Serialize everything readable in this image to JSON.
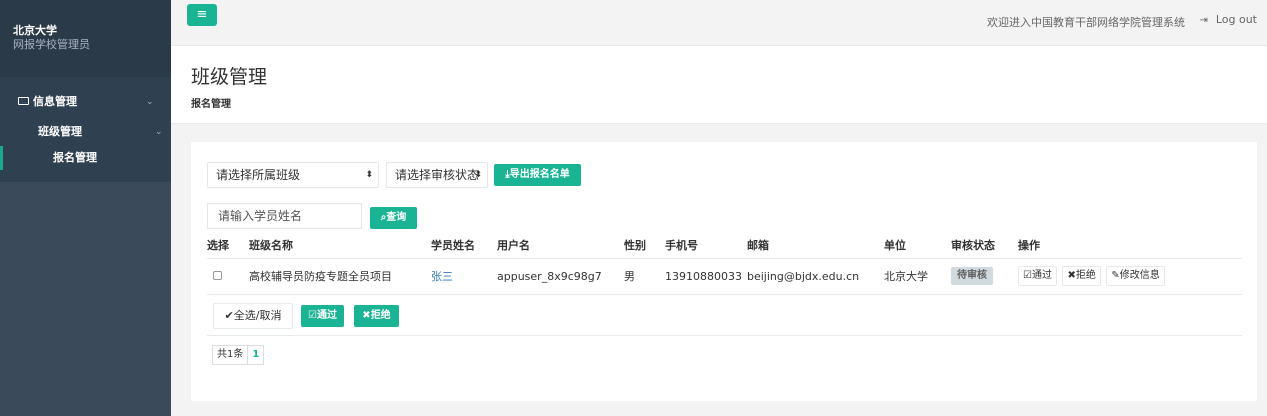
{
  "sidebar": {
    "org_name": "北京大学",
    "role_name": "网报学校管理员",
    "menu": {
      "info_mgmt": "信息管理",
      "class_mgmt": "班级管理",
      "signup_mgmt": "报名管理"
    }
  },
  "topbar": {
    "menu_icon": "≡",
    "welcome": "欢迎进入中国教育干部网络学院管理系统",
    "logout": "Log out"
  },
  "heading": {
    "title": "班级管理",
    "breadcrumb": "报名管理"
  },
  "filters": {
    "class_select": "请选择所属班级",
    "status_select": "请选择审核状态",
    "export_button": "导出报名名单",
    "name_placeholder": "请输入学员姓名",
    "search_button": "查询"
  },
  "table": {
    "headers": [
      "选择",
      "班级名称",
      "学员姓名",
      "用户名",
      "性别",
      "手机号",
      "邮箱",
      "单位",
      "审核状态",
      "操作"
    ],
    "rows": [
      {
        "class_name": "高校辅导员防疫专题全员项目",
        "student_name": "张三",
        "username": "appuser_8x9c98g7",
        "gender": "男",
        "phone": "13910880033",
        "email": "beijing@bjdx.edu.cn",
        "unit": "北京大学",
        "status": "待审核",
        "actions": {
          "approve": "通过",
          "reject": "拒绝",
          "edit": "修改信息"
        }
      }
    ]
  },
  "bulk": {
    "select_all": "全选/取消",
    "approve": "通过",
    "reject": "拒绝"
  },
  "pagination": {
    "total": "共1条",
    "page": "1"
  },
  "colors": {
    "primary": "#1ab394",
    "sidebar": "#2f4050",
    "link": "#337ab7"
  }
}
